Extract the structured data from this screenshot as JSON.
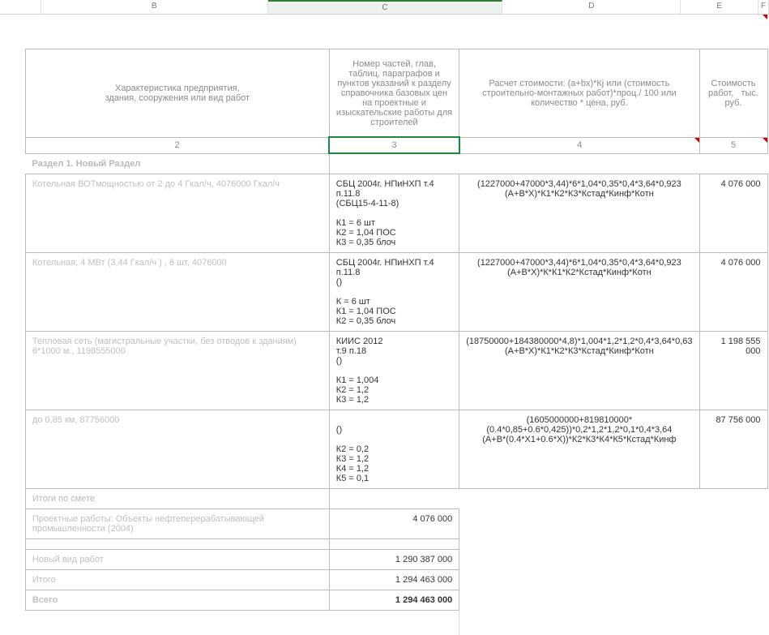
{
  "columns": {
    "B": "B",
    "C": "C",
    "D": "D",
    "E": "E",
    "F": "F"
  },
  "headers": {
    "b": "Характеристика предприятия,\nздания, сооружения или вид работ",
    "c": "Номер частей, глав, таблиц, параграфов и пунктов указаний к разделу справочника базовых цен на проектные и изыскательские работы для строителей",
    "d": "Расчет стоимости: (a+bx)*Кj или (стоимость строительно-монтажных работ)*проц./ 100 или количество * цена, руб.",
    "e": "Стоимость работ,   тыс. руб."
  },
  "numrow": {
    "b": "2",
    "c": "3",
    "d": "4",
    "e": "5"
  },
  "section_title": "Раздел 1. Новый Раздел",
  "rows": [
    {
      "b": "Котельная ВОТмощностью от 2 до 4 Гкал/ч, 4076000 Гкал/ч",
      "c": "СБЦ 2004г. НПиНХП т.4 п.11.8\n(СБЦ15-4-11-8)\n\nК1 = 6 шт\nК2 = 1,04 ПОС\nК3 = 0,35 блоч",
      "d": "(1227000+47000*3,44)*6*1,04*0,35*0,4*3,64*0,923\n(А+В*Х)*К1*К2*К3*Кстад*Кинф*Котн",
      "e": "4 076 000"
    },
    {
      "b": "Котельная, 4 МВт (3,44 Гкал/ч ) , 6 шт, 4076000",
      "c": "СБЦ 2004г. НПиНХП т.4 п.11.8\n()\n\nК = 6 шт\nК1 = 1,04 ПОС\nК2 = 0,35 блоч",
      "d": "(1227000+47000*3,44)*6*1,04*0,35*0,4*3,64*0,923\n(А+В*Х)*К*К1*К2*Кстад*Кинф*Котн",
      "e": "4 076 000"
    },
    {
      "b": "Тепловая сеть (магистральные участки, без отводов к зданиям) 6*1000 м., 1198555000",
      "c": "КИИС 2012\nт.9 п.18\n()\n\nК1 = 1,004\nК2 = 1,2\nК3 = 1,2",
      "d": "(18750000+184380000*4,8)*1,004*1,2*1,2*0,4*3,64*0,63\n(А+В*Х)*К1*К2*К3*Кстад*Кинф*Котн",
      "e": "1 198 555 000"
    },
    {
      "b": "до 0,85 км, 87756000",
      "c": "\n()\n\nК2 = 0,2\nК3 = 1,2\nК4 = 1,2\nК5 = 0,1",
      "d": "(1605000000+819810000*(0.4*0,85+0.6*0,425))*0,2*1,2*1,2*0,1*0,4*3,64\n(А+В*(0.4*Х1+0.6*Х))*К2*К3*К4*К5*Кстад*Кинф",
      "e": "87 756 000"
    }
  ],
  "totals": {
    "itogi_label": "Итоги по смете",
    "line1_label": "Проектные работы: Объекты нефтеперерабатывающей промышленности (2004)",
    "line1_value": "4 076 000",
    "line2_label": "Новый вид работ",
    "line2_value": "1 290 387 000",
    "line3_label": "Итого",
    "line3_value": "1 294 463 000",
    "line4_label": "Всего",
    "line4_value": "1 294 463 000"
  }
}
